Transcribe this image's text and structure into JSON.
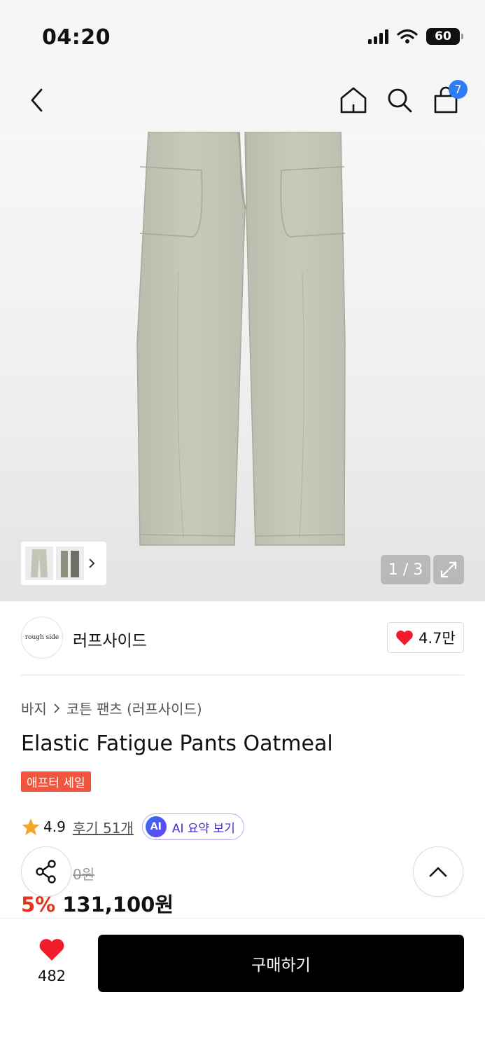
{
  "status_bar": {
    "time": "04:20",
    "battery": "60"
  },
  "nav": {
    "cart_count": "7",
    "icons": [
      "back-icon",
      "home-icon",
      "search-icon",
      "cart-icon"
    ]
  },
  "gallery": {
    "page_indicator": "1 / 3"
  },
  "brand": {
    "logo_text": "rough side",
    "name": "러프사이드",
    "likes": "4.7만"
  },
  "product": {
    "breadcrumb": [
      "바지",
      "코튼 팬츠 (러프사이드)"
    ],
    "title": "Elastic Fatigue Pants Oatmeal",
    "sale_badge": "애프터 세일",
    "rating": "4.9",
    "review_link": "후기 51개",
    "ai_badge": "AI",
    "ai_summary_label": "AI 요약 보기",
    "original_price": "0원",
    "discount": "5%",
    "price": "131,100원"
  },
  "bottom": {
    "wish_count": "482",
    "buy_label": "구매하기"
  },
  "colors": {
    "accent_red": "#e8331c",
    "sale_badge": "#f2553d",
    "cart_badge": "#2f7df6",
    "heart": "#f01c2c",
    "star": "#f5a623"
  }
}
